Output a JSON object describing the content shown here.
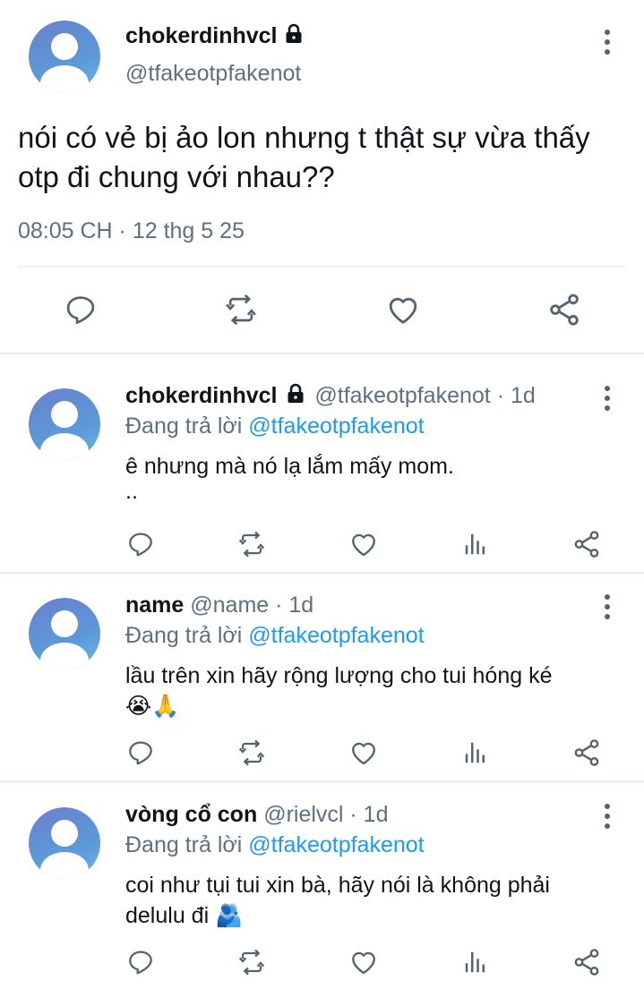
{
  "main_tweet": {
    "display_name": "chokerdinhvcl",
    "handle": "@tfakeotpfakenot",
    "text_line1": "nói có vẻ bị ảo lon nhưng t thật sự vừa thấy",
    "text_line2": "otp đi chung với nhau??",
    "timestamp": "08:05 CH · 12 thg 5 25"
  },
  "replies": [
    {
      "display_name": "chokerdinhvcl",
      "meta": "@tfakeotpfakenot · 1d",
      "replying_prefix": "Đang trả lời ",
      "replying_to": "@tfakeotpfakenot",
      "text_line1": "ê nhưng mà nó lạ lắm mấy mom.",
      "text_line2": ".."
    },
    {
      "display_name": "name",
      "meta": "@name · 1d",
      "replying_prefix": "Đang trả lời ",
      "replying_to": "@tfakeotpfakenot",
      "text_line1": "lầu trên xin hãy rộng lượng cho tui hóng ké",
      "text_line2": "😭🙏"
    },
    {
      "display_name": "vòng cổ con",
      "meta": "@rielvcl · 1d",
      "replying_prefix": "Đang trả lời ",
      "replying_to": "@tfakeotpfakenot",
      "text_line1": "coi như tụi tui xin bà, hãy nói là không phải",
      "text_line2": "delulu đi 🫂"
    }
  ],
  "colors": {
    "link": "#1d9bf0",
    "muted": "#5b7083",
    "icon": "#536471"
  }
}
